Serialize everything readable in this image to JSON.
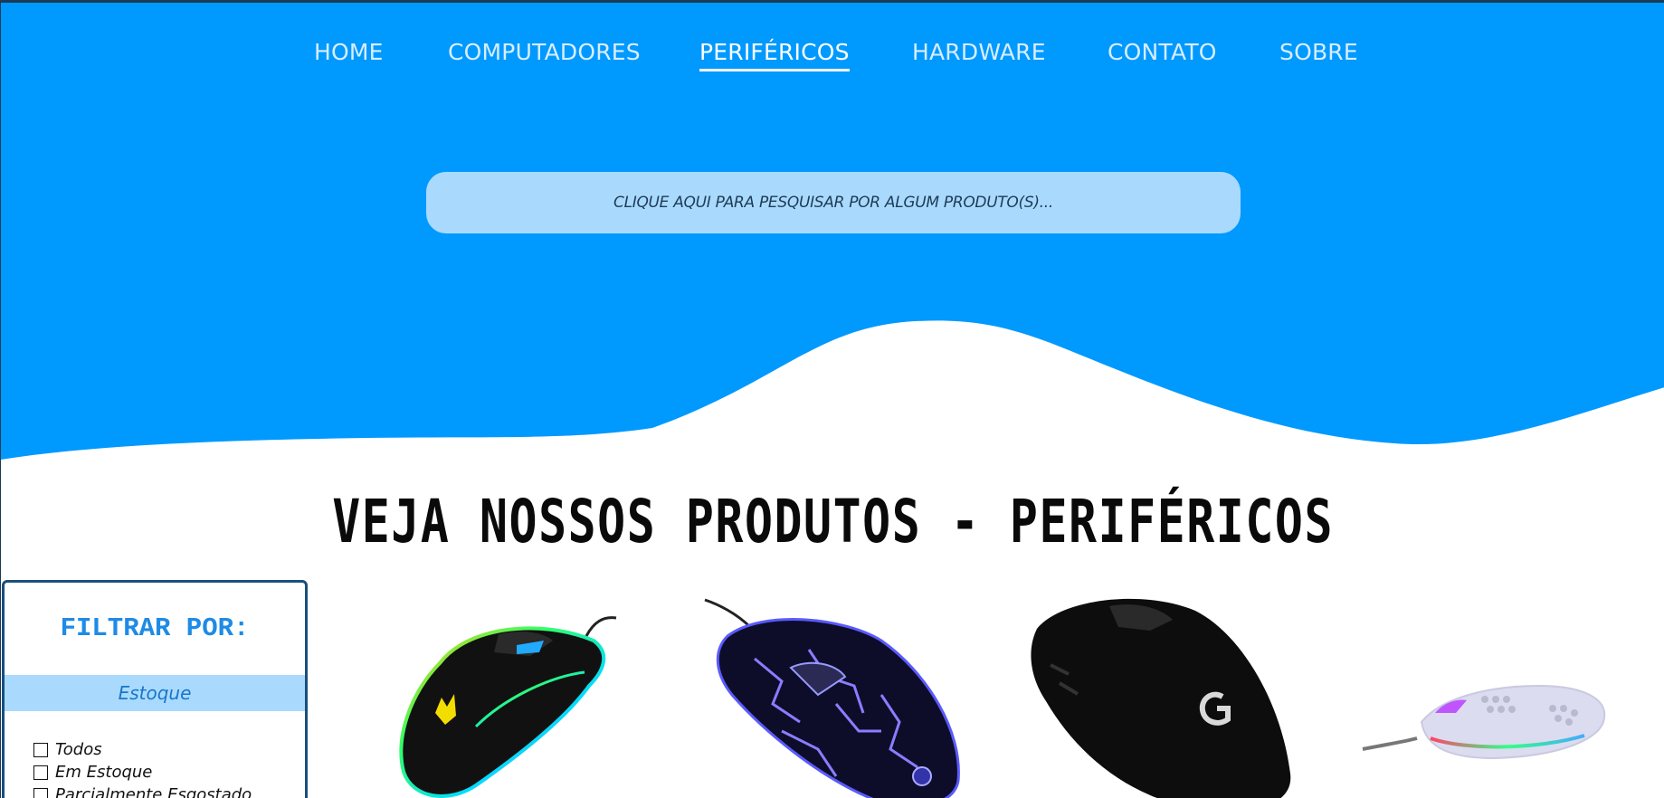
{
  "nav": {
    "items": [
      {
        "label": "HOME"
      },
      {
        "label": "COMPUTADORES"
      },
      {
        "label": "PERIFÉRICOS"
      },
      {
        "label": "HARDWARE"
      },
      {
        "label": "CONTATO"
      },
      {
        "label": "SOBRE"
      }
    ],
    "active": "PERIFÉRICOS"
  },
  "search": {
    "placeholder": "CLIQUE AQUI PARA PESQUISAR POR ALGUM PRODUTO(S)..."
  },
  "section": {
    "title": "VEJA NOSSOS PRODUTOS - PERIFÉRICOS"
  },
  "filter": {
    "title": "FILTRAR POR:",
    "group_label": "Estoque",
    "options": [
      {
        "label": "Todos"
      },
      {
        "label": "Em Estoque"
      },
      {
        "label": "Parcialmente Esgostado"
      }
    ]
  },
  "products": [
    {
      "icon": "rgb-gaming-mouse-image"
    },
    {
      "icon": "blue-crackle-gaming-mouse-image"
    },
    {
      "icon": "black-logitech-mouse-image"
    },
    {
      "icon": "white-honeycomb-mouse-image"
    }
  ],
  "colors": {
    "hero_blue": "#0099fe",
    "search_bg": "#a9dafe",
    "filter_border": "#1a4f7c",
    "filter_title": "#1e8be6"
  }
}
